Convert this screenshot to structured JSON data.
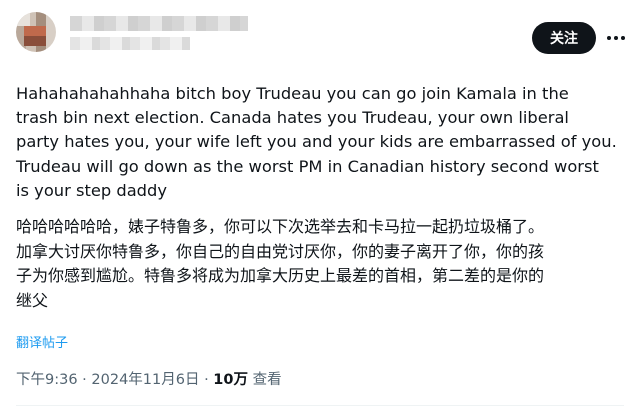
{
  "header": {
    "follow_label": "关注",
    "more_icon": "more-horizontal-icon"
  },
  "tweet": {
    "original_text": "Hahahahahahhaha bitch boy Trudeau you can go join Kamala in the\ntrash bin next election. Canada hates you Trudeau, your own liberal\nparty hates you, your wife left you and your kids are embarrassed of you.\nTrudeau will go down as the worst PM in Canadian history second worst\nis your step daddy",
    "translated_text": "哈哈哈哈哈哈，婊子特鲁多，你可以下次选举去和卡马拉一起扔垃圾桶了。\n加拿大讨厌你特鲁多，你自己的自由党讨厌你，你的妻子离开了你，你的孩\n子为你感到尴尬。特鲁多将成为加拿大历史上最差的首相，第二差的是你的\n继父",
    "translate_label": "翻译帖子"
  },
  "meta": {
    "time": "下午9:36",
    "separator": " · ",
    "date": "2024年11月6日",
    "views_count": "10万",
    "views_label": " 查看"
  },
  "colors": {
    "follow_bg": "#0f1419",
    "link": "#1d9bf0",
    "meta_text": "#536471"
  }
}
